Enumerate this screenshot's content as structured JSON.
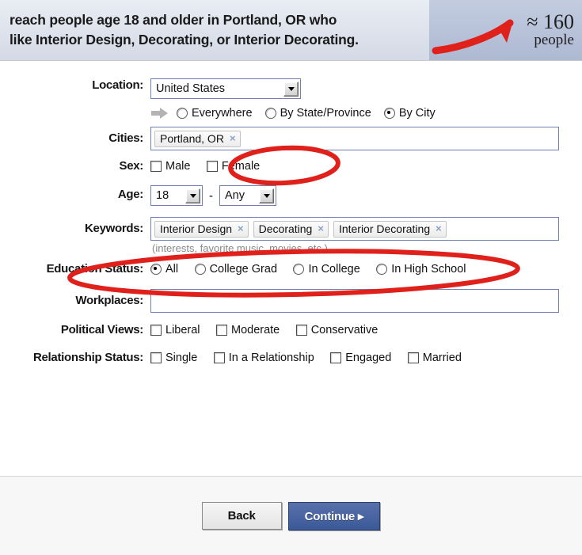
{
  "header": {
    "sentence": "reach people age 18 and older in Portland, OR who\nlike Interior Design, Decorating, or Interior Decorating.",
    "estimate_number": "≈ 160",
    "estimate_label": "people",
    "arrow_color": "#e0201b",
    "panel_color": "#b8c3da"
  },
  "form": {
    "location": {
      "label": "Location:",
      "selected": "United States",
      "scope_options": [
        {
          "label": "Everywhere",
          "selected": false
        },
        {
          "label": "By State/Province",
          "selected": false
        },
        {
          "label": "By City",
          "selected": true
        }
      ]
    },
    "cities": {
      "label": "Cities:",
      "tokens": [
        "Portland, OR"
      ],
      "remove_glyph": "×"
    },
    "sex": {
      "label": "Sex:",
      "options": [
        {
          "label": "Male",
          "checked": false
        },
        {
          "label": "Female",
          "checked": false
        }
      ]
    },
    "age": {
      "label": "Age:",
      "min": "18",
      "separator": "-",
      "max": "Any"
    },
    "keywords": {
      "label": "Keywords:",
      "tokens": [
        "Interior Design",
        "Decorating",
        "Interior Decorating"
      ],
      "hint": "(interests, favorite music, movies, etc.)",
      "remove_glyph": "×"
    },
    "education": {
      "label": "Education Status:",
      "options": [
        {
          "label": "All",
          "selected": true
        },
        {
          "label": "College Grad",
          "selected": false
        },
        {
          "label": "In College",
          "selected": false
        },
        {
          "label": "In High School",
          "selected": false
        }
      ]
    },
    "workplaces": {
      "label": "Workplaces:",
      "value": "",
      "placeholder": ""
    },
    "political": {
      "label": "Political Views:",
      "options": [
        {
          "label": "Liberal",
          "checked": false
        },
        {
          "label": "Moderate",
          "checked": false
        },
        {
          "label": "Conservative",
          "checked": false
        }
      ]
    },
    "relationship": {
      "label": "Relationship Status:",
      "options": [
        {
          "label": "Single",
          "checked": false
        },
        {
          "label": "In a Relationship",
          "checked": false
        },
        {
          "label": "Engaged",
          "checked": false
        },
        {
          "label": "Married",
          "checked": false
        }
      ]
    }
  },
  "footer": {
    "back_label": "Back",
    "continue_label": "Continue",
    "continue_arrow": "▸"
  },
  "annotations": {
    "color": "#e0201b",
    "shapes": [
      "cities-oval",
      "keywords-oval",
      "header-arrow"
    ]
  }
}
